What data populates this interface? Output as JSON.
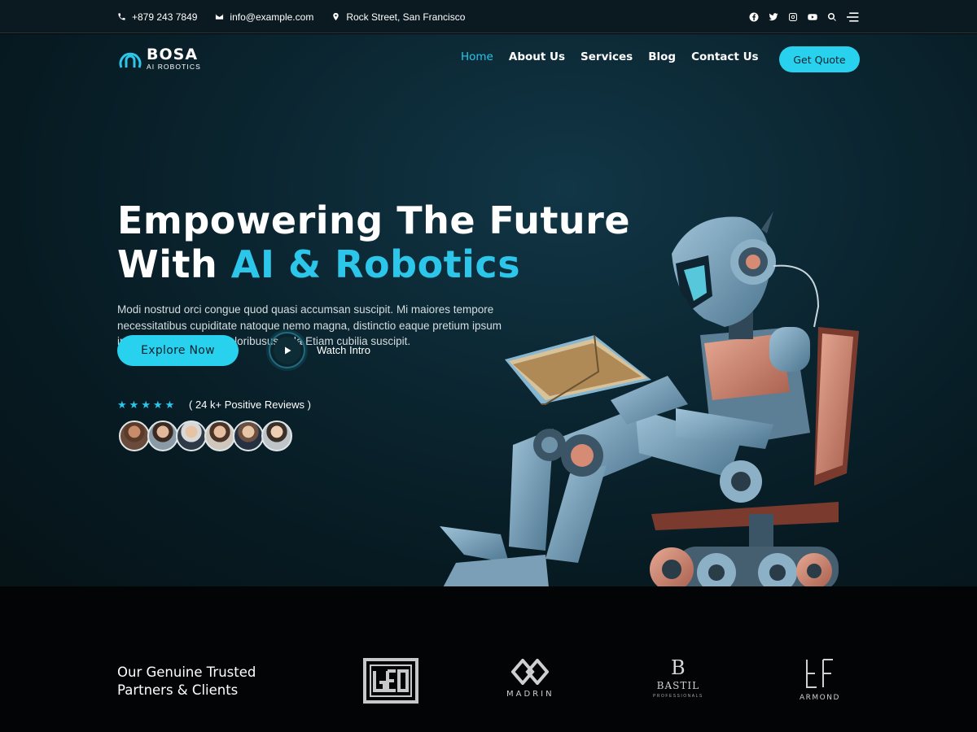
{
  "topbar": {
    "phone": "+879 243 7849",
    "email": "info@example.com",
    "address": "Rock Street, San Francisco",
    "social_icons": [
      "facebook-icon",
      "twitter-icon",
      "instagram-icon",
      "youtube-icon",
      "search-icon",
      "menu-icon"
    ]
  },
  "brand": {
    "name": "BOSA",
    "tagline": "AI ROBOTICS"
  },
  "nav": {
    "items": [
      "Home",
      "About Us",
      "Services",
      "Blog",
      "Contact Us"
    ],
    "active": "Home",
    "cta": "Get Quote"
  },
  "hero": {
    "title_line1": "Empowering The Future",
    "title_line2_plain": "With ",
    "title_line2_highlight": "AI & Robotics",
    "description": "Modi nostrud orci congue quod quasi accumsan suscipit. Mi maiores tempore necessitatibus cupiditate natoque nemo magna, distinctio eaque pretium ipsum integer mi maecenas doloribususasda Etiam cubilia suscipit.",
    "primary_button": "Explore Now",
    "secondary_button": "Watch Intro",
    "rating_stars": 5,
    "reviews_text": "( 24 k+ Positive Reviews )"
  },
  "partners": {
    "title_line1": "Our Genuine Trusted",
    "title_line2": "Partners & Clients",
    "logos": [
      {
        "name": "GEO",
        "caption": ""
      },
      {
        "name": "MADRIN",
        "caption": "MADRIN"
      },
      {
        "name": "BASTIL",
        "caption": "BASTIL",
        "subcaption": "PROFESSIONALS"
      },
      {
        "name": "ARMOND",
        "caption": "ARMOND"
      }
    ]
  },
  "colors": {
    "accent": "#28d2ef",
    "hero_bg": "#0b2631",
    "footer_bg": "#030405"
  }
}
